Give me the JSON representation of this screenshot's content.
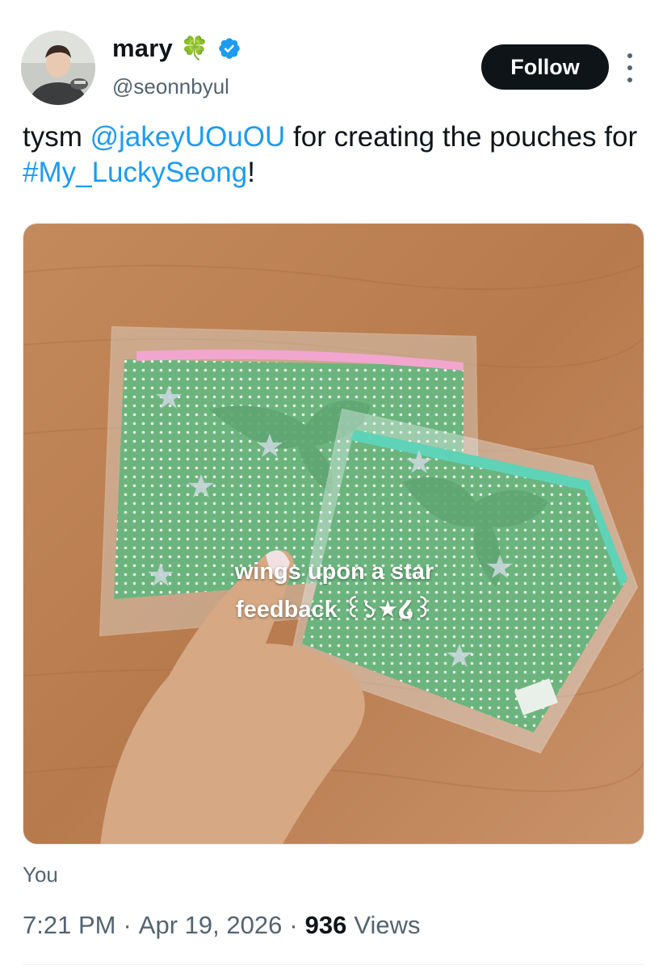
{
  "author": {
    "name": "mary",
    "name_emoji": "🍀",
    "handle": "@seonnbyul"
  },
  "follow_label": "Follow",
  "tweet": {
    "text_prefix": "tysm ",
    "mention": "@jakeyUOuOU",
    "text_middle": " for creating the pouches for ",
    "hashtag": "#My_LuckySeong",
    "text_suffix": "!"
  },
  "media_overlay": {
    "line1": "wings upon a star",
    "line2": "feedback ꒰১★໒꒱"
  },
  "source_label": "You",
  "meta": {
    "time": "7:21 PM",
    "separator": "·",
    "date": "Apr 19, 2026",
    "views_count": "936",
    "views_label": "Views"
  },
  "colors": {
    "link": "#1d9bf0",
    "follow_bg": "#0f1419",
    "verified": "#1d9bf0",
    "pouch_green": "#6cb47e",
    "pouch_zipper_large": "#f2a6cf",
    "pouch_zipper_small": "#5ed3b8",
    "floor": "#b77a4c"
  },
  "icons": {
    "verified": "verified-badge-icon",
    "more": "more-options-icon"
  }
}
